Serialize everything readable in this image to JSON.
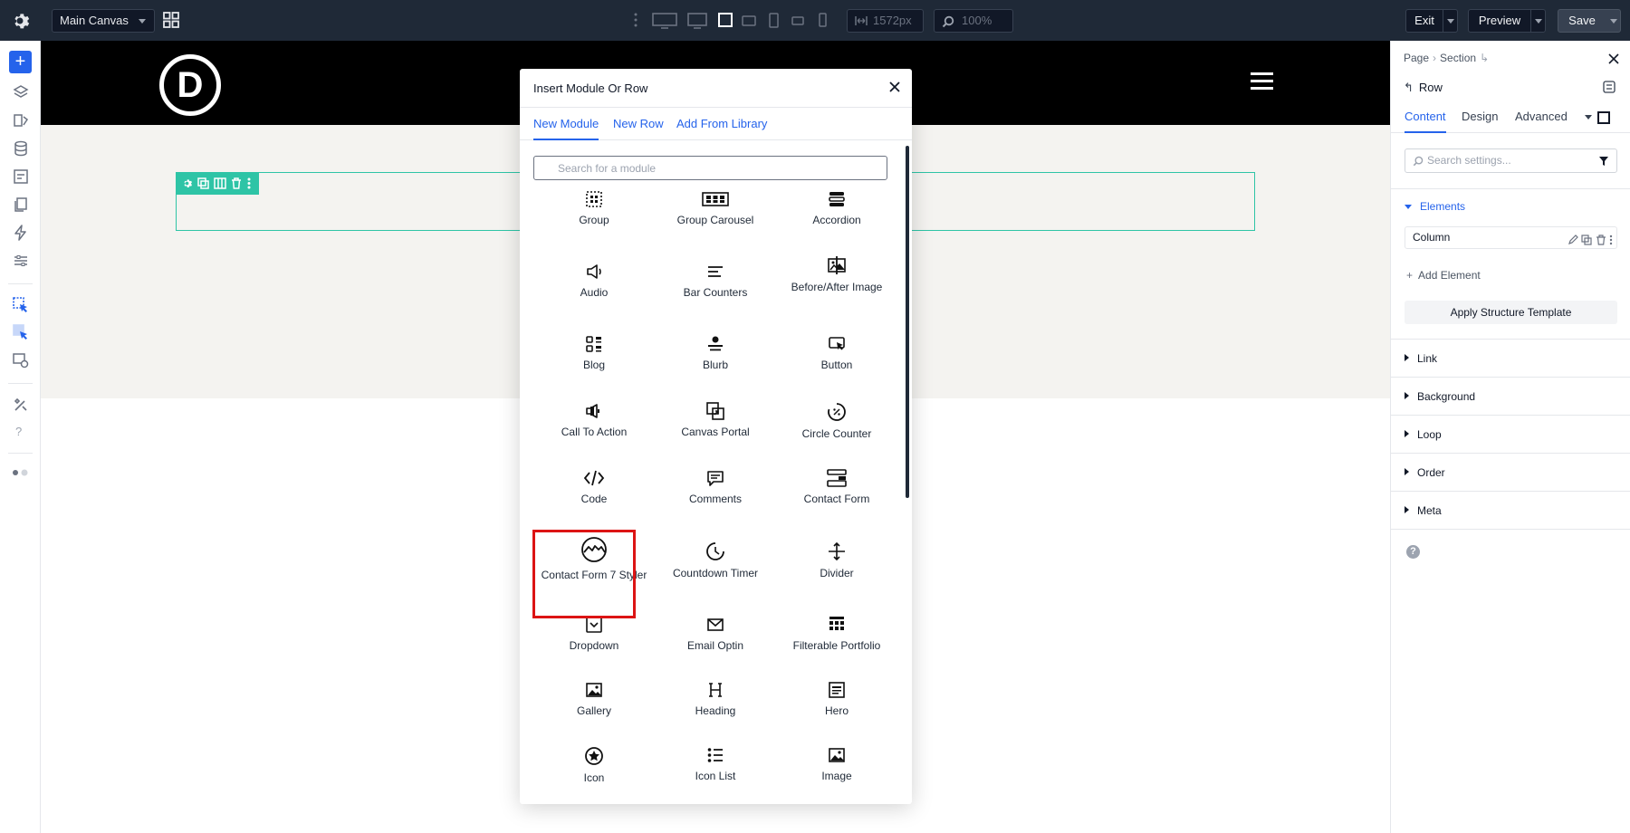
{
  "topbar": {
    "canvas_name": "Main Canvas",
    "width_value": "1572px",
    "zoom_value": "100%",
    "exit_label": "Exit",
    "preview_label": "Preview",
    "save_label": "Save"
  },
  "modal": {
    "title": "Insert Module Or Row",
    "tabs": [
      "New Module",
      "New Row",
      "Add From Library"
    ],
    "active_tab": "New Module",
    "search_placeholder": "Search for a module",
    "modules": [
      {
        "label": "Group",
        "icon": "group-icon"
      },
      {
        "label": "Group Carousel",
        "icon": "group-carousel-icon"
      },
      {
        "label": "Accordion",
        "icon": "accordion-icon"
      },
      {
        "label": "Audio",
        "icon": "audio-icon"
      },
      {
        "label": "Bar Counters",
        "icon": "bar-counters-icon"
      },
      {
        "label": "Before/After Image",
        "icon": "before-after-image-icon"
      },
      {
        "label": "Blog",
        "icon": "blog-icon"
      },
      {
        "label": "Blurb",
        "icon": "blurb-icon"
      },
      {
        "label": "Button",
        "icon": "button-icon"
      },
      {
        "label": "Call To Action",
        "icon": "call-to-action-icon"
      },
      {
        "label": "Canvas Portal",
        "icon": "canvas-portal-icon"
      },
      {
        "label": "Circle Counter",
        "icon": "circle-counter-icon"
      },
      {
        "label": "Code",
        "icon": "code-icon"
      },
      {
        "label": "Comments",
        "icon": "comments-icon"
      },
      {
        "label": "Contact Form",
        "icon": "contact-form-icon"
      },
      {
        "label": "Contact Form 7 Styler",
        "icon": "contact-form-7-styler-icon",
        "highlighted": true
      },
      {
        "label": "Countdown Timer",
        "icon": "countdown-timer-icon"
      },
      {
        "label": "Divider",
        "icon": "divider-icon"
      },
      {
        "label": "Dropdown",
        "icon": "dropdown-icon"
      },
      {
        "label": "Email Optin",
        "icon": "email-optin-icon"
      },
      {
        "label": "Filterable Portfolio",
        "icon": "filterable-portfolio-icon"
      },
      {
        "label": "Gallery",
        "icon": "gallery-icon"
      },
      {
        "label": "Heading",
        "icon": "heading-icon"
      },
      {
        "label": "Hero",
        "icon": "hero-icon"
      },
      {
        "label": "Icon",
        "icon": "icon-module-icon"
      },
      {
        "label": "Icon List",
        "icon": "icon-list-icon"
      },
      {
        "label": "Image",
        "icon": "image-icon"
      }
    ]
  },
  "site": {
    "logo_letter": "D"
  },
  "panel": {
    "breadcrumb": [
      "Page",
      "Section"
    ],
    "element_title": "Row",
    "tabs": [
      "Content",
      "Design",
      "Advanced"
    ],
    "active_tab": "Content",
    "search_placeholder": "Search settings...",
    "elements_header": "Elements",
    "column_item": "Column",
    "add_element": "Add Element",
    "apply_template": "Apply Structure Template",
    "sections": [
      "Link",
      "Background",
      "Loop",
      "Order",
      "Meta"
    ],
    "help": "?"
  },
  "colors": {
    "accent": "#2563eb",
    "row_outline": "#2ec4a6",
    "highlight": "#dc1414",
    "topbar": "#1f2937"
  }
}
